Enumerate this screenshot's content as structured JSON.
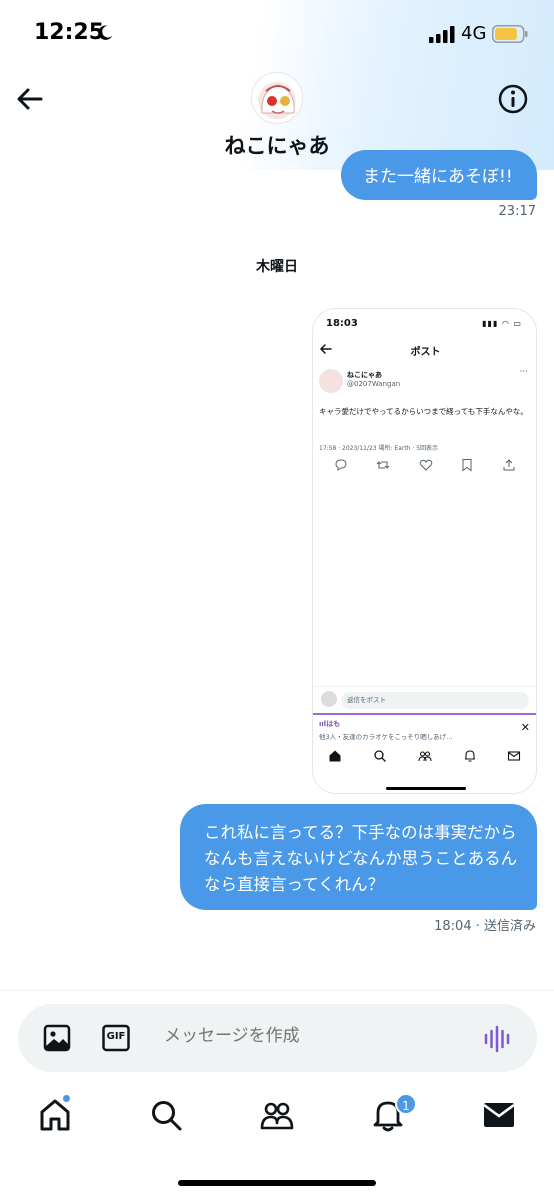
{
  "status_bar": {
    "time": "12:25",
    "network": "4G",
    "battery_color": "#f5c542"
  },
  "header": {
    "name": "ねこにゃあ",
    "back_icon": "arrow-left-icon",
    "info_icon": "info-icon"
  },
  "messages": {
    "partial_text": "また一緒にあそぼ!!",
    "partial_time": "23:17",
    "day_separator": "木曜日",
    "main_text": "これ私に言ってる？下手なのは事実だからなんも言えないけどなんか思うことあるんなら直接言ってくれん？",
    "main_time": "18:04 · 送信済み"
  },
  "screenshot": {
    "time": "18:03",
    "status_icons": "▮▮▮ ◠ ▭",
    "title": "ポスト",
    "name": "ねこにゃあ",
    "handle": "@0207Wangan",
    "text": "キャラ愛だけでやってるからいつまで経っても下手なんやな。",
    "meta": "17:58 · 2023/11/23 場所: Earth · 5回表示",
    "reply_placeholder": "返信をポスト",
    "space_title": "ıılはも",
    "space_sub": "他3人・友達のカラオケをこっそり晒しあげ…",
    "more": "···",
    "close": "✕"
  },
  "composer": {
    "placeholder": "メッセージを作成",
    "gif_label": "GIF"
  },
  "tabbar": {
    "notification_count": "1"
  },
  "colors": {
    "accent": "#4a99e9",
    "voice": "#7b5cd6",
    "text": "#0f1419",
    "muted": "#536471"
  }
}
